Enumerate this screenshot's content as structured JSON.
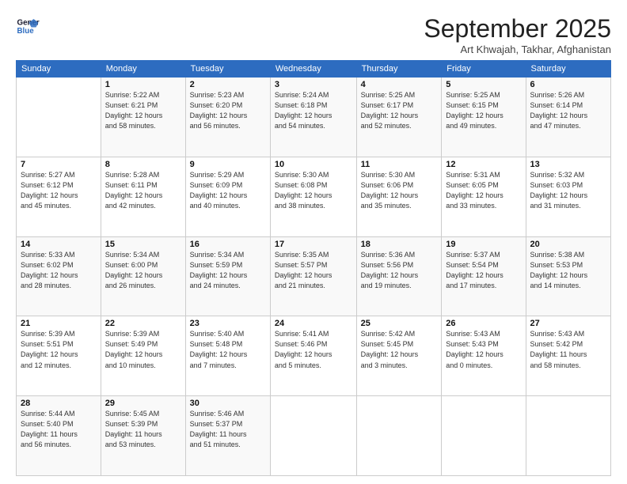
{
  "logo": {
    "line1": "General",
    "line2": "Blue"
  },
  "title": "September 2025",
  "location": "Art Khwajah, Takhar, Afghanistan",
  "weekdays": [
    "Sunday",
    "Monday",
    "Tuesday",
    "Wednesday",
    "Thursday",
    "Friday",
    "Saturday"
  ],
  "weeks": [
    [
      {
        "day": "",
        "info": ""
      },
      {
        "day": "1",
        "info": "Sunrise: 5:22 AM\nSunset: 6:21 PM\nDaylight: 12 hours\nand 58 minutes."
      },
      {
        "day": "2",
        "info": "Sunrise: 5:23 AM\nSunset: 6:20 PM\nDaylight: 12 hours\nand 56 minutes."
      },
      {
        "day": "3",
        "info": "Sunrise: 5:24 AM\nSunset: 6:18 PM\nDaylight: 12 hours\nand 54 minutes."
      },
      {
        "day": "4",
        "info": "Sunrise: 5:25 AM\nSunset: 6:17 PM\nDaylight: 12 hours\nand 52 minutes."
      },
      {
        "day": "5",
        "info": "Sunrise: 5:25 AM\nSunset: 6:15 PM\nDaylight: 12 hours\nand 49 minutes."
      },
      {
        "day": "6",
        "info": "Sunrise: 5:26 AM\nSunset: 6:14 PM\nDaylight: 12 hours\nand 47 minutes."
      }
    ],
    [
      {
        "day": "7",
        "info": "Sunrise: 5:27 AM\nSunset: 6:12 PM\nDaylight: 12 hours\nand 45 minutes."
      },
      {
        "day": "8",
        "info": "Sunrise: 5:28 AM\nSunset: 6:11 PM\nDaylight: 12 hours\nand 42 minutes."
      },
      {
        "day": "9",
        "info": "Sunrise: 5:29 AM\nSunset: 6:09 PM\nDaylight: 12 hours\nand 40 minutes."
      },
      {
        "day": "10",
        "info": "Sunrise: 5:30 AM\nSunset: 6:08 PM\nDaylight: 12 hours\nand 38 minutes."
      },
      {
        "day": "11",
        "info": "Sunrise: 5:30 AM\nSunset: 6:06 PM\nDaylight: 12 hours\nand 35 minutes."
      },
      {
        "day": "12",
        "info": "Sunrise: 5:31 AM\nSunset: 6:05 PM\nDaylight: 12 hours\nand 33 minutes."
      },
      {
        "day": "13",
        "info": "Sunrise: 5:32 AM\nSunset: 6:03 PM\nDaylight: 12 hours\nand 31 minutes."
      }
    ],
    [
      {
        "day": "14",
        "info": "Sunrise: 5:33 AM\nSunset: 6:02 PM\nDaylight: 12 hours\nand 28 minutes."
      },
      {
        "day": "15",
        "info": "Sunrise: 5:34 AM\nSunset: 6:00 PM\nDaylight: 12 hours\nand 26 minutes."
      },
      {
        "day": "16",
        "info": "Sunrise: 5:34 AM\nSunset: 5:59 PM\nDaylight: 12 hours\nand 24 minutes."
      },
      {
        "day": "17",
        "info": "Sunrise: 5:35 AM\nSunset: 5:57 PM\nDaylight: 12 hours\nand 21 minutes."
      },
      {
        "day": "18",
        "info": "Sunrise: 5:36 AM\nSunset: 5:56 PM\nDaylight: 12 hours\nand 19 minutes."
      },
      {
        "day": "19",
        "info": "Sunrise: 5:37 AM\nSunset: 5:54 PM\nDaylight: 12 hours\nand 17 minutes."
      },
      {
        "day": "20",
        "info": "Sunrise: 5:38 AM\nSunset: 5:53 PM\nDaylight: 12 hours\nand 14 minutes."
      }
    ],
    [
      {
        "day": "21",
        "info": "Sunrise: 5:39 AM\nSunset: 5:51 PM\nDaylight: 12 hours\nand 12 minutes."
      },
      {
        "day": "22",
        "info": "Sunrise: 5:39 AM\nSunset: 5:49 PM\nDaylight: 12 hours\nand 10 minutes."
      },
      {
        "day": "23",
        "info": "Sunrise: 5:40 AM\nSunset: 5:48 PM\nDaylight: 12 hours\nand 7 minutes."
      },
      {
        "day": "24",
        "info": "Sunrise: 5:41 AM\nSunset: 5:46 PM\nDaylight: 12 hours\nand 5 minutes."
      },
      {
        "day": "25",
        "info": "Sunrise: 5:42 AM\nSunset: 5:45 PM\nDaylight: 12 hours\nand 3 minutes."
      },
      {
        "day": "26",
        "info": "Sunrise: 5:43 AM\nSunset: 5:43 PM\nDaylight: 12 hours\nand 0 minutes."
      },
      {
        "day": "27",
        "info": "Sunrise: 5:43 AM\nSunset: 5:42 PM\nDaylight: 11 hours\nand 58 minutes."
      }
    ],
    [
      {
        "day": "28",
        "info": "Sunrise: 5:44 AM\nSunset: 5:40 PM\nDaylight: 11 hours\nand 56 minutes."
      },
      {
        "day": "29",
        "info": "Sunrise: 5:45 AM\nSunset: 5:39 PM\nDaylight: 11 hours\nand 53 minutes."
      },
      {
        "day": "30",
        "info": "Sunrise: 5:46 AM\nSunset: 5:37 PM\nDaylight: 11 hours\nand 51 minutes."
      },
      {
        "day": "",
        "info": ""
      },
      {
        "day": "",
        "info": ""
      },
      {
        "day": "",
        "info": ""
      },
      {
        "day": "",
        "info": ""
      }
    ]
  ]
}
